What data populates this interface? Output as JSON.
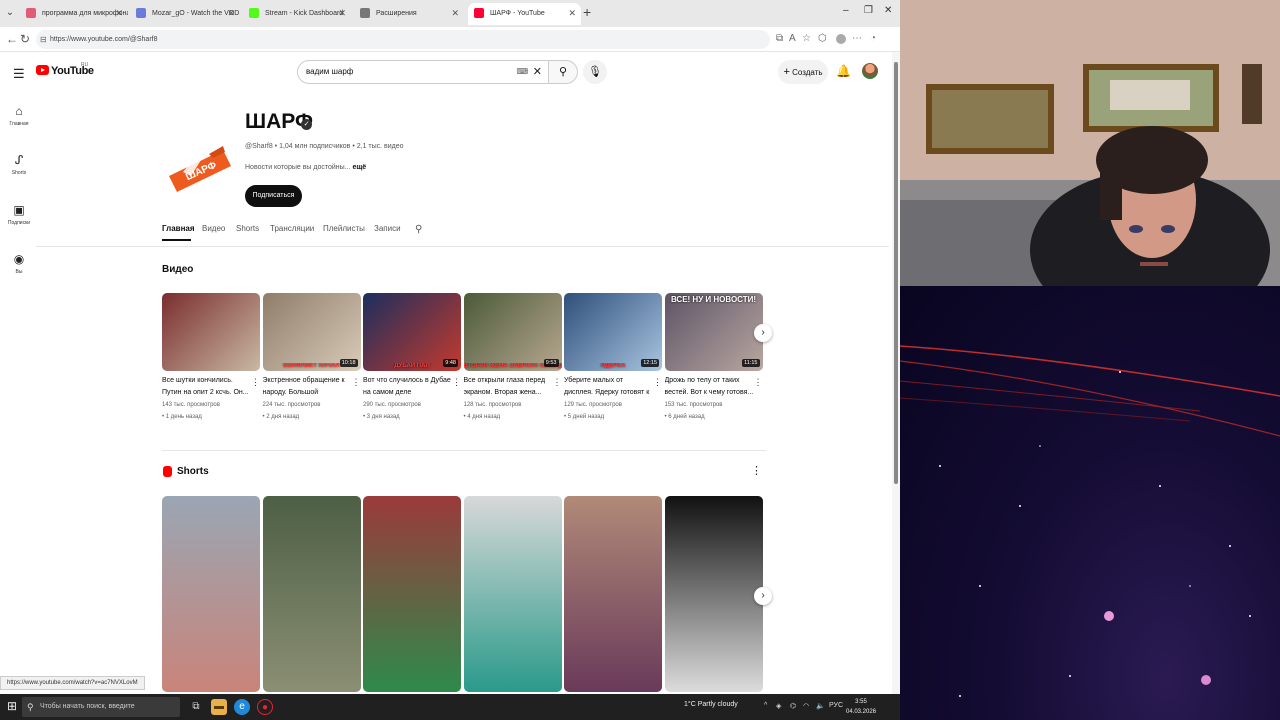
{
  "browser": {
    "tabs": [
      {
        "title": "программа для микрофона фиф",
        "favicon_color": "#e25b77",
        "active": false
      },
      {
        "title": "Mozar_gO - Watch the VOD on Kic",
        "favicon_color": "#6a7bd8",
        "active": false
      },
      {
        "title": "Stream - Kick Dashboard",
        "favicon_color": "#53fc18",
        "active": false
      },
      {
        "title": "Расширения",
        "favicon_color": "#777777",
        "active": false
      },
      {
        "title": "ШАРФ - YouTube",
        "favicon_color": "#ff0033",
        "active": true
      }
    ],
    "url": "https://www.youtube.com/@Sharf8",
    "status_url": "https://www.youtube.com/watch?v=ac7NVXLovM"
  },
  "youtube": {
    "logo_text": "YouTube",
    "country": "RU",
    "search_value": "вадим шарф",
    "create_label": "Создать",
    "sidebar": [
      {
        "label": "Главная",
        "icon": "home-icon"
      },
      {
        "label": "Shorts",
        "icon": "shorts-icon"
      },
      {
        "label": "Подписки",
        "icon": "subscriptions-icon"
      },
      {
        "label": "Вы",
        "icon": "you-icon"
      }
    ],
    "channel": {
      "name": "ШАРФ",
      "logo_text": "ШАРФ",
      "handle": "@Sharf8",
      "meta": "@Sharf8 • 1,04 млн подписчиков • 2,1 тыс. видео",
      "description": "Новости которые вы достойны...",
      "description_more": "ещё",
      "subscribe_label": "Подписаться",
      "tabs": [
        "Главная",
        "Видео",
        "Shorts",
        "Трансляции",
        "Плейлисты",
        "Записи"
      ]
    },
    "videos_section_title": "Видео",
    "videos": [
      {
        "title": "Все шутки кончились. Путин на опит 2 ксчь. Он...",
        "views": "143 тыс. просмотров",
        "date": "• 1 день назад",
        "duration": "",
        "caption": "",
        "colors": [
          "#7a2e2e",
          "#c9b8a4"
        ]
      },
      {
        "title": "Экстренное обращение к народу. Большой конфлик...",
        "views": "224 тыс. просмотров",
        "date": "• 2 дня назад",
        "duration": "10:18",
        "caption": "КОНФЛИКТ НАЧАЛ",
        "colors": [
          "#8f7d6a",
          "#d8cbb8"
        ]
      },
      {
        "title": "Вот что случилось в Дубае на самом деле",
        "views": "290 тыс. просмотров",
        "date": "• 3 дня назад",
        "duration": "9:48",
        "caption": "ДУБАЙ ПАЛ",
        "colors": [
          "#1c2e5e",
          "#c43a2e"
        ]
      },
      {
        "title": "Все открыли глаза перед экраном. Вторая жена...",
        "views": "128 тыс. просмотров",
        "date": "• 4 дня назад",
        "duration": "9:53",
        "caption": "ВТОРАЯ ЖЕНА ЗАБРАЛА СЕБЕ ДЕ",
        "colors": [
          "#4c5a3a",
          "#b7a890"
        ]
      },
      {
        "title": "Уберите малых от дисплея. Ядерку готовят к действию",
        "views": "129 тыс. просмотров",
        "date": "• 5 дней назад",
        "duration": "12:15",
        "caption": "ЯДЕРКА",
        "colors": [
          "#2f4f7a",
          "#a8c4e0"
        ]
      },
      {
        "title": "Дрожь по телу от таких вестей. Вот к чему готовя...",
        "views": "153 тыс. просмотров",
        "date": "• 6 дней назад",
        "duration": "11:15",
        "caption": "ВСЕ! НУ И НОВОСТИ!",
        "colors": [
          "#5e5366",
          "#b8a8a0"
        ]
      }
    ],
    "shorts_section_title": "Shorts",
    "shorts": [
      {
        "colors": [
          "#9aa6b4",
          "#c9847a"
        ]
      },
      {
        "colors": [
          "#4d5f44",
          "#8b8f74"
        ]
      },
      {
        "colors": [
          "#9b3a3a",
          "#2e8a4a"
        ]
      },
      {
        "colors": [
          "#d8d8d8",
          "#2a9a8a"
        ]
      },
      {
        "colors": [
          "#b18a78",
          "#6a3a5a"
        ]
      },
      {
        "colors": [
          "#111111",
          "#dcdcdc"
        ]
      }
    ]
  },
  "taskbar": {
    "search_placeholder": "Чтобы начать поиск, введите",
    "weather": "1°C  Partly cloudy",
    "lang": "РУС",
    "time": "3:55",
    "date": "04.03.2026"
  }
}
